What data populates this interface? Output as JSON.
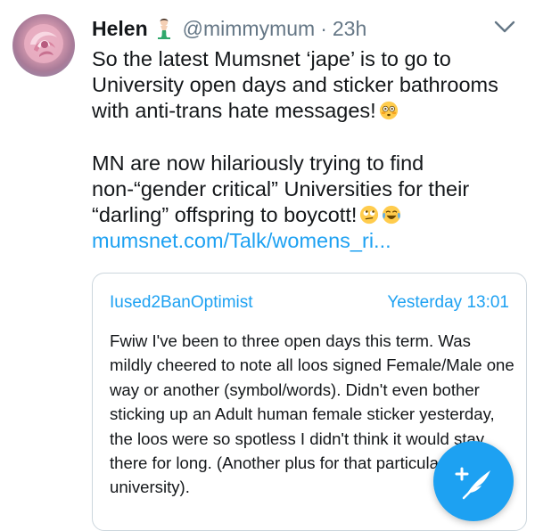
{
  "tweet": {
    "display_name": "Helen",
    "handle": "@mimmymum",
    "separator": "·",
    "time": "23h",
    "paragraph1": "So the latest Mumsnet ‘jape’ is to go to University open days and sticker bathrooms with anti-trans hate messages!",
    "paragraph2": "MN are now hilariously trying to find non-“gender critical” Universities for their “darling” offspring to boycott!",
    "link": "mumsnet.com/Talk/womens_ri..."
  },
  "quote": {
    "username": "Iused2BanOptimist",
    "date": "Yesterday 13:01",
    "body": "Fwiw I've been to three open days this term. Was mildly cheered to note all loos signed Female/Male one way or another (symbol/words). Didn't even bother sticking up an Adult human female sticker yesterday, the loos were so spotless I didn't think it would stay there for long. (Another plus for that particular university)."
  },
  "icons": {
    "avatar": "rose-avatar",
    "name_badge": "mermaid-emoji",
    "menu": "chevron-down-icon",
    "emoji1": "flushed-face-emoji",
    "emoji2": "eye-roll-emoji",
    "emoji3": "crying-laughing-emoji",
    "compose": "compose-tweet-icon"
  },
  "colors": {
    "link_blue": "#1da1f2",
    "secondary_text": "#657786",
    "border": "#ccd6dd"
  }
}
